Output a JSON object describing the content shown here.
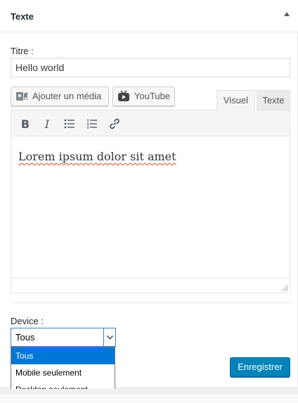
{
  "widget": {
    "title": "Texte"
  },
  "title_field": {
    "label": "Titre :",
    "value": "Hello world"
  },
  "media_buttons": {
    "add_media": "Ajouter un média",
    "youtube": "YouTube"
  },
  "editor_tabs": {
    "visual": "Visuel",
    "text": "Texte"
  },
  "toolbar": {
    "bold": "B",
    "italic": "I",
    "icons": [
      "bold-icon",
      "italic-icon",
      "bullet-list-icon",
      "numbered-list-icon",
      "link-icon"
    ]
  },
  "editor": {
    "content": "Lorem ipsum dolor sit amet"
  },
  "device": {
    "label": "Device :",
    "selected": "Tous",
    "options": [
      "Tous",
      "Mobile seulement",
      "Desktop seulement"
    ]
  },
  "actions": {
    "save": "Enregistrer"
  },
  "colors": {
    "primary": "#0085ba",
    "selection": "#0078d7",
    "border": "#e5e5e5"
  }
}
